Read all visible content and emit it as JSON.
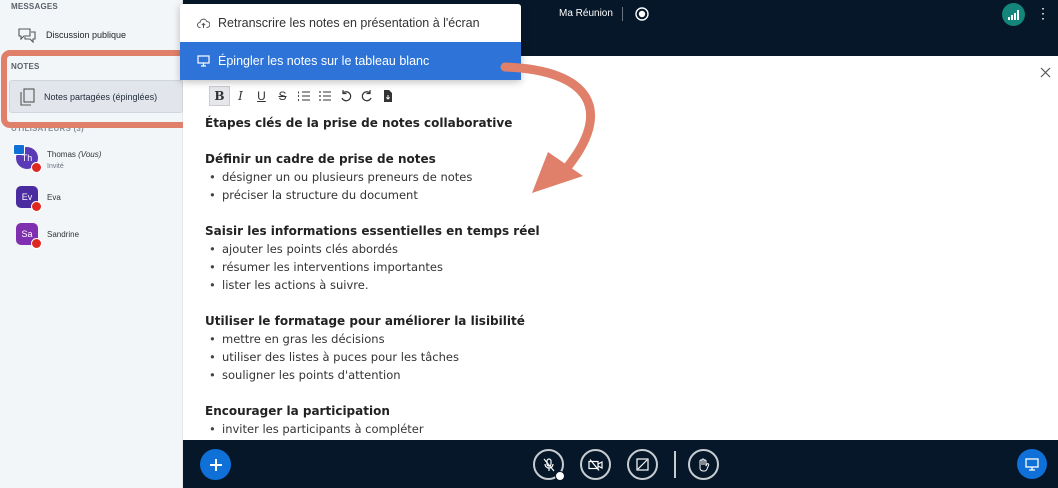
{
  "sidebar": {
    "messages_title": "MESSAGES",
    "public_chat": "Discussion publique",
    "notes_title": "NOTES",
    "shared_notes": "Notes partagées (épinglées)",
    "users_title": "UTILISATEURS (3)",
    "users": [
      {
        "initials": "Th",
        "name": "Thomas",
        "you": "(Vous)",
        "role": "Invité",
        "color": "#5b3ab8"
      },
      {
        "initials": "Ev",
        "name": "Eva",
        "color": "#4a2ba0"
      },
      {
        "initials": "Sa",
        "name": "Sandrine",
        "color": "#7f2fb0"
      }
    ]
  },
  "topbar": {
    "meeting_title": "Ma Réunion",
    "record_icon": "record-icon",
    "connection_icon": "signal-icon"
  },
  "menu": {
    "items": [
      {
        "label": "Retranscrire les notes en présentation à l'écran",
        "icon": "cloud-upload-icon"
      },
      {
        "label": "Épingler les notes sur le tableau blanc",
        "icon": "presentation-icon",
        "selected": true
      }
    ]
  },
  "toolbar": {
    "buttons": [
      "B",
      "I",
      "U",
      "S",
      "ordered-list",
      "bullet-list",
      "undo",
      "redo",
      "export"
    ]
  },
  "document": {
    "title": "Étapes clés de la prise de notes collaborative",
    "sections": [
      {
        "heading": "Définir un cadre de prise de notes",
        "items": [
          "désigner un ou plusieurs preneurs de notes",
          "préciser la structure du document"
        ]
      },
      {
        "heading": "Saisir les informations essentielles en temps réel",
        "items": [
          "ajouter les points clés abordés",
          "résumer les interventions importantes",
          "lister les actions à suivre."
        ]
      },
      {
        "heading": "Utiliser le formatage pour améliorer la lisibilité",
        "items": [
          "mettre en gras les décisions",
          "utiliser des listes à puces pour les tâches",
          "souligner les points d'attention"
        ]
      },
      {
        "heading": "Encourager la participation",
        "items": [
          "inviter les participants à compléter"
        ]
      }
    ]
  },
  "colors": {
    "accent": "#0f70d7",
    "highlight": "#e0806a",
    "dark_bar": "#06172a"
  }
}
